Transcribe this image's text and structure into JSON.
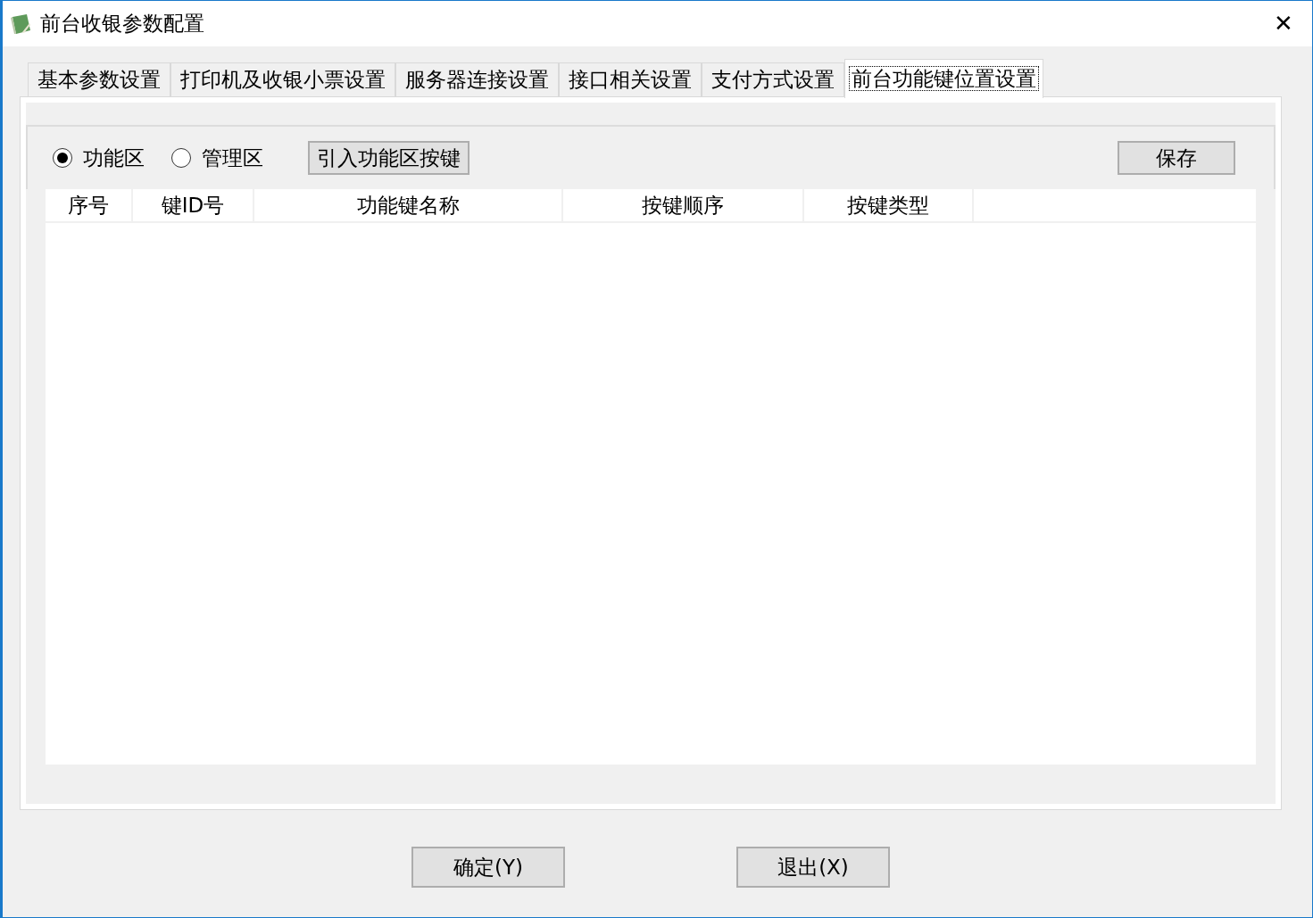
{
  "window": {
    "title": "前台收银参数配置",
    "close": "✕"
  },
  "tabs": [
    {
      "label": "基本参数设置",
      "selected": false
    },
    {
      "label": "打印机及收银小票设置",
      "selected": false
    },
    {
      "label": "服务器连接设置",
      "selected": false
    },
    {
      "label": "接口相关设置",
      "selected": false
    },
    {
      "label": "支付方式设置",
      "selected": false
    },
    {
      "label": "前台功能键位置设置",
      "selected": true
    }
  ],
  "radios": [
    {
      "label": "功能区",
      "selected": true
    },
    {
      "label": "管理区",
      "selected": false
    }
  ],
  "import_button": "引入功能区按键",
  "save_button": "保存",
  "table": {
    "columns": [
      "序号",
      "键ID号",
      "功能键名称",
      "按键顺序",
      "按键类型"
    ]
  },
  "buttons": [
    "确定(Y)",
    "退出(X)"
  ]
}
